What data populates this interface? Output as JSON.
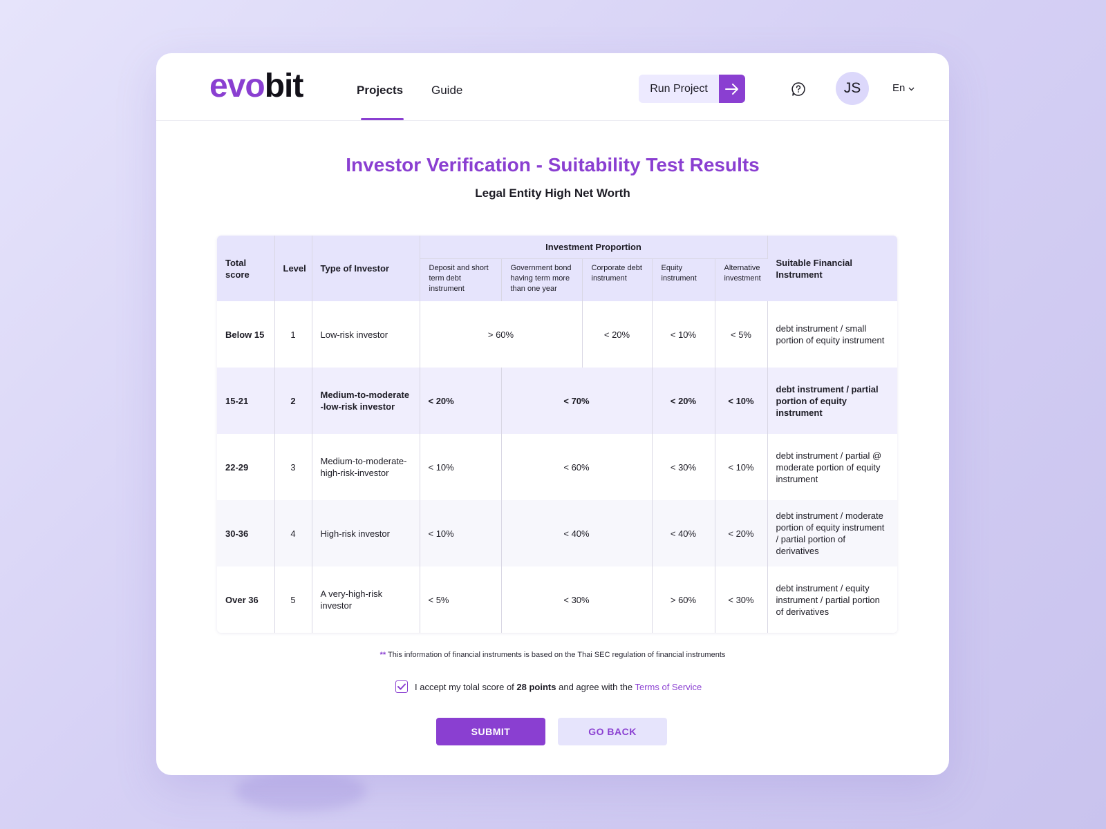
{
  "header": {
    "logo_part1": "evo",
    "logo_part2": "bit",
    "tabs": [
      {
        "label": "Projects",
        "active": true
      },
      {
        "label": "Guide",
        "active": false
      }
    ],
    "run_project_label": "Run Project",
    "avatar_initials": "JS",
    "language": "En"
  },
  "page": {
    "title": "Investor Verification - Suitability Test Results",
    "subtitle": "Legal Entity High Net Worth"
  },
  "table": {
    "headers": {
      "total_score": "Total score",
      "level": "Level",
      "type": "Type of Investor",
      "group": "Investment Proportion",
      "deposit": "Deposit and short term debt instrument",
      "govbond": "Government bond having term more than one year",
      "corporate": "Corporate debt instrument",
      "equity": "Equity instrument",
      "alternative": "Alternative investment",
      "suitable": "Suitable Financial Instrument"
    },
    "rows": [
      {
        "score": "Below 15",
        "level": "1",
        "type": "Low-risk investor",
        "deposit_gov": "> 60%",
        "corporate": "< 20%",
        "equity": "< 10%",
        "alternative": "< 5%",
        "suitable": "debt instrument / small portion of equity instrument"
      },
      {
        "score": "15-21",
        "level": "2",
        "type": "Medium-to-moderate -low-risk investor",
        "deposit": "< 20%",
        "gov_corp": "< 70%",
        "equity": "< 20%",
        "alternative": "< 10%",
        "suitable": "debt instrument / partial portion of equity instrument"
      },
      {
        "score": "22-29",
        "level": "3",
        "type": "Medium-to-moderate-high-risk-investor",
        "deposit": "< 10%",
        "gov_corp": "< 60%",
        "equity": "< 30%",
        "alternative": "< 10%",
        "suitable": "debt instrument / partial @ moderate portion of equity instrument"
      },
      {
        "score": "30-36",
        "level": "4",
        "type": "High-risk investor",
        "deposit": "< 10%",
        "gov_corp": "< 40%",
        "equity": "< 40%",
        "alternative": "< 20%",
        "suitable": "debt instrument / moderate portion of equity instrument / partial portion of derivatives"
      },
      {
        "score": "Over 36",
        "level": "5",
        "type": "A very-high-risk investor",
        "deposit": "< 5%",
        "gov_corp": "< 30%",
        "equity": "> 60%",
        "alternative": "< 30%",
        "suitable": "debt instrument / equity instrument / partial portion of derivatives"
      }
    ]
  },
  "footer": {
    "note_stars": "**",
    "note_text": "This information of financial instruments is based on the Thai SEC regulation of financial instruments",
    "accept_prefix": "I accept my tolal score of",
    "accept_points": "28 points",
    "accept_middle": "and agree with the",
    "accept_tos": "Terms of Service",
    "accept_checked": true,
    "submit_label": "SUBMIT",
    "back_label": "GO BACK"
  },
  "colors": {
    "accent": "#8a3fd1",
    "header_bg": "#e6e4fc",
    "highlight_row": "#f0eefd"
  },
  "icons": [
    "arrow-right-icon",
    "help-icon",
    "chevron-down-icon",
    "check-icon"
  ]
}
